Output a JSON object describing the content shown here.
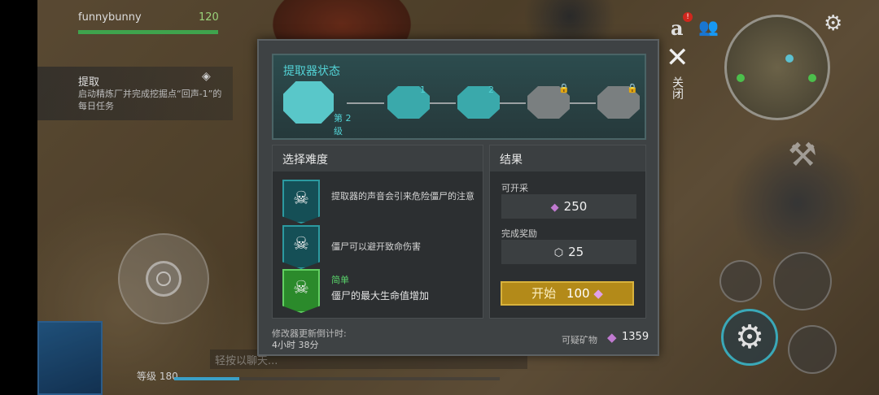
{
  "player": {
    "name": "funnybunny",
    "count": "120"
  },
  "quest": {
    "title": "提取",
    "description": "启动精炼厂并完成挖掘点“回声-1”的每日任务"
  },
  "chat": {
    "placeholder": "轻按以聊天..."
  },
  "level": {
    "label": "等级 180",
    "progress": 0.2
  },
  "hud": {
    "notification_badge": "!",
    "close_label": "关闭"
  },
  "dialog": {
    "status_title": "提取器状态",
    "stages": [
      {
        "label": "",
        "state": "current"
      },
      {
        "label": "1",
        "state": "unlocked"
      },
      {
        "label": "2",
        "state": "unlocked"
      },
      {
        "label": "",
        "state": "locked"
      },
      {
        "label": "",
        "state": "locked"
      }
    ],
    "level_label": "第 2 级",
    "difficulty": {
      "title": "选择难度",
      "options": [
        {
          "text": "提取器的声音会引来危险僵尸的注意",
          "icon": "skull-icon"
        },
        {
          "text": "僵尸可以避开致命伤害",
          "icon": "skull-plus-icon"
        },
        {
          "tag": "简单",
          "text": "僵尸的最大生命值增加",
          "icon": "skull-heart-icon",
          "selected": true
        }
      ]
    },
    "result": {
      "title": "结果",
      "minable_label": "可开采",
      "minable_value": "250",
      "reward_label": "完成奖励",
      "reward_value": "25",
      "start_label": "开始",
      "start_cost": "100"
    },
    "timer_label": "修改器更新倒计时:",
    "timer_value": "4小时 38分",
    "resource_label": "可疑矿物",
    "resource_value": "1359"
  },
  "colors": {
    "accent": "#53d3d6",
    "start_button": "#b38a19",
    "easy": "#59d36a"
  }
}
